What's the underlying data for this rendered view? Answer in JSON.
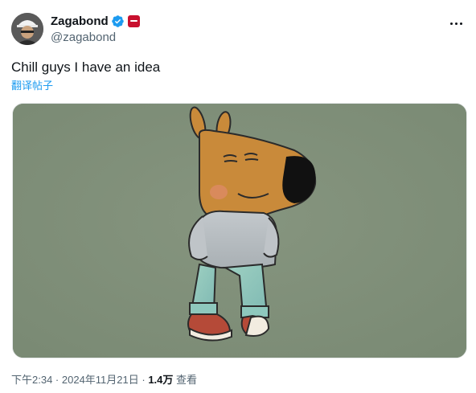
{
  "author": {
    "display_name": "Zagabond",
    "handle": "@zagabond"
  },
  "tweet": {
    "text": "Chill guys I have an idea",
    "translate_label": "翻译帖子"
  },
  "meta": {
    "time": "下午2:34",
    "separator1": " · ",
    "date": "2024年11月21日",
    "separator2": " · ",
    "views_count": "1.4万",
    "views_label": " 查看"
  },
  "colors": {
    "verified_blue": "#1d9bf0",
    "affiliate_red": "#c8102e",
    "link_blue": "#1d9bf0",
    "image_background": "#7f8f79"
  },
  "icons": {
    "verified": "verified-badge-icon",
    "affiliate": "affiliate-badge-icon",
    "more": "more-options-icon"
  }
}
